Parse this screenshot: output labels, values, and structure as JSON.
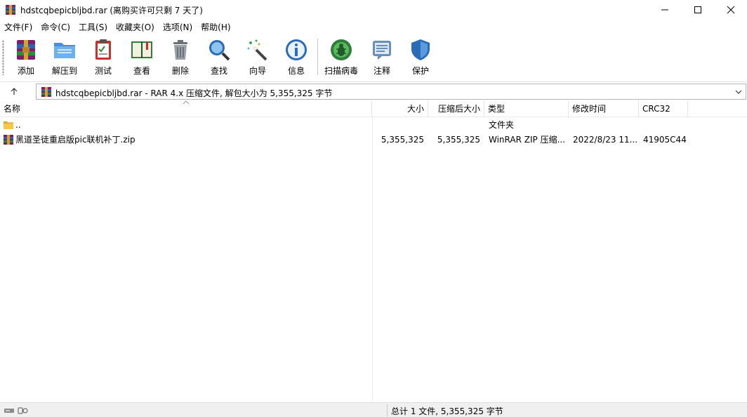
{
  "window": {
    "title": "hdstcqbepicbljbd.rar (离购买许可只剩 7 天了)"
  },
  "menu": [
    {
      "label": "文件(F)"
    },
    {
      "label": "命令(C)"
    },
    {
      "label": "工具(S)"
    },
    {
      "label": "收藏夹(O)"
    },
    {
      "label": "选项(N)"
    },
    {
      "label": "帮助(H)"
    }
  ],
  "toolbar": [
    {
      "label": "添加",
      "icon": "add-archive-icon"
    },
    {
      "label": "解压到",
      "icon": "extract-folder-icon"
    },
    {
      "label": "测试",
      "icon": "test-clipboard-icon"
    },
    {
      "label": "查看",
      "icon": "view-book-icon"
    },
    {
      "label": "删除",
      "icon": "trash-icon"
    },
    {
      "label": "查找",
      "icon": "magnifier-icon"
    },
    {
      "label": "向导",
      "icon": "wizard-wand-icon"
    },
    {
      "label": "信息",
      "icon": "info-icon"
    },
    {
      "label": "扫描病毒",
      "icon": "virus-scan-icon"
    },
    {
      "label": "注释",
      "icon": "comment-icon"
    },
    {
      "label": "保护",
      "icon": "shield-icon"
    }
  ],
  "address": {
    "text": "hdstcqbepicbljbd.rar - RAR 4.x 压缩文件, 解包大小为 5,355,325 字节"
  },
  "columns": [
    {
      "label": "名称"
    },
    {
      "label": "大小"
    },
    {
      "label": "压缩后大小"
    },
    {
      "label": "类型"
    },
    {
      "label": "修改时间"
    },
    {
      "label": "CRC32"
    }
  ],
  "rows": [
    {
      "name": "..",
      "size": "",
      "packed": "",
      "type": "文件夹",
      "modified": "",
      "crc": ""
    },
    {
      "name": "黑道圣徒重启版pic联机补丁.zip",
      "size": "5,355,325",
      "packed": "5,355,325",
      "type": "WinRAR ZIP 压缩...",
      "modified": "2022/8/23 11...",
      "crc": "41905C44"
    }
  ],
  "status": {
    "text": "总计 1 文件, 5,355,325 字节"
  },
  "colors": {
    "rar_red": "#b4232a",
    "folder_yellow": "#f5c84b"
  }
}
